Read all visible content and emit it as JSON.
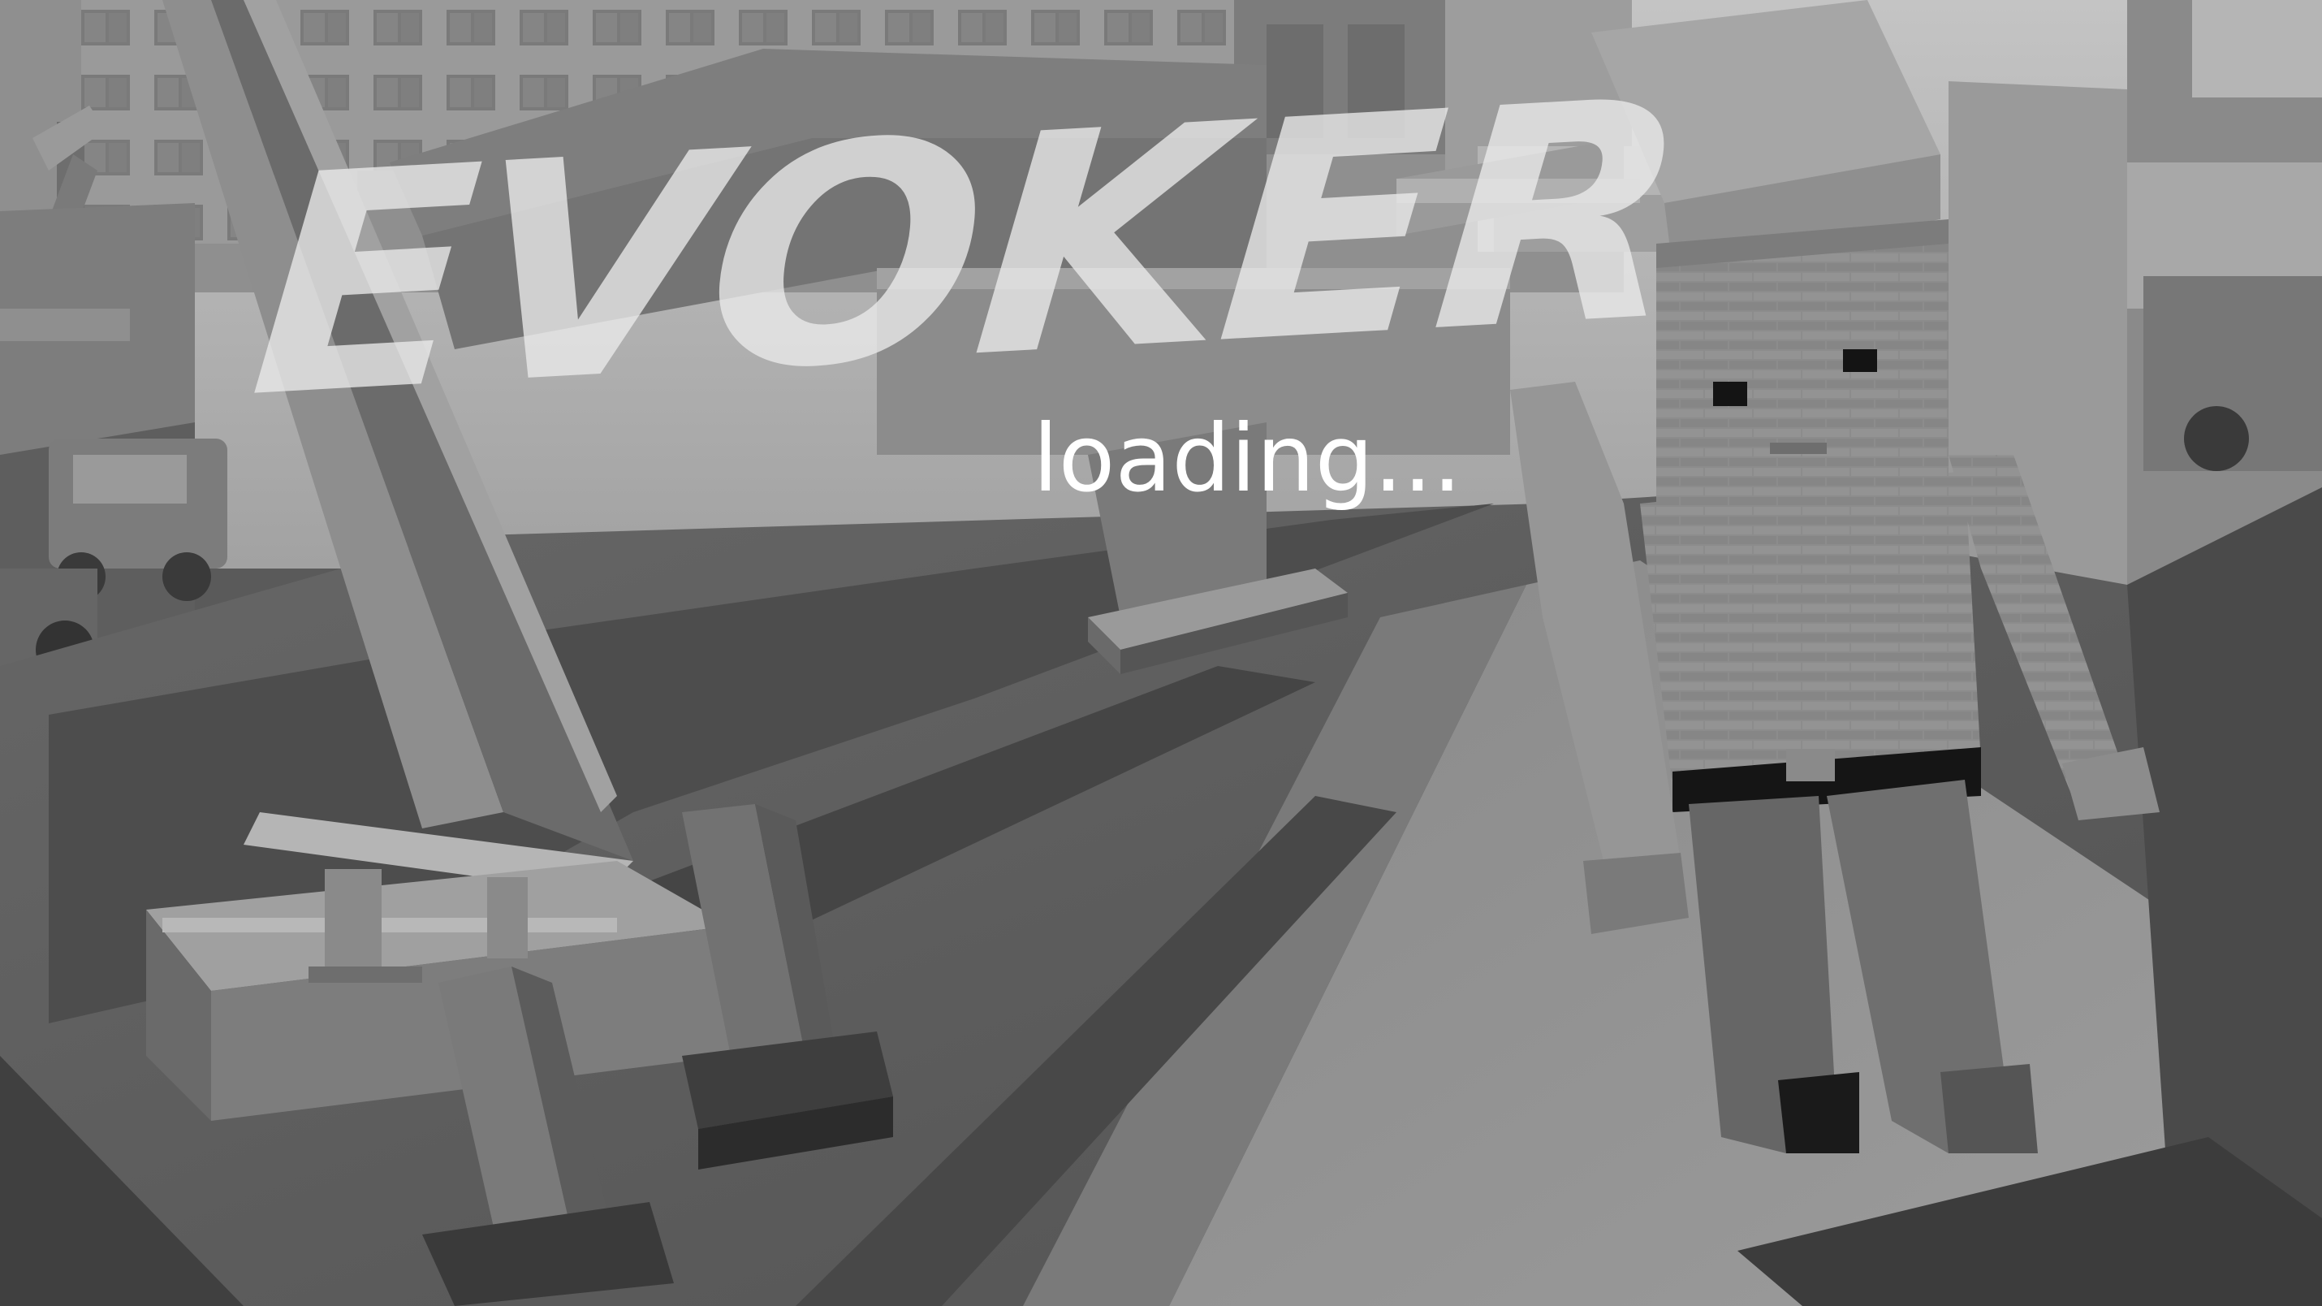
{
  "title": "EVOKER",
  "status": "loading...",
  "palette": {
    "sky": "#b8b8b8",
    "building_light": "#a9a9a9",
    "building_mid": "#8b8b8b",
    "building_dark": "#6a6a6a",
    "road": "#5c5c5c",
    "shadow": "#3d3d3d",
    "sidewalk": "#8e8e8e",
    "character_body": "#8a8a8a",
    "character_dark": "#101010"
  },
  "icons": [
    "street-lamp-icon"
  ]
}
